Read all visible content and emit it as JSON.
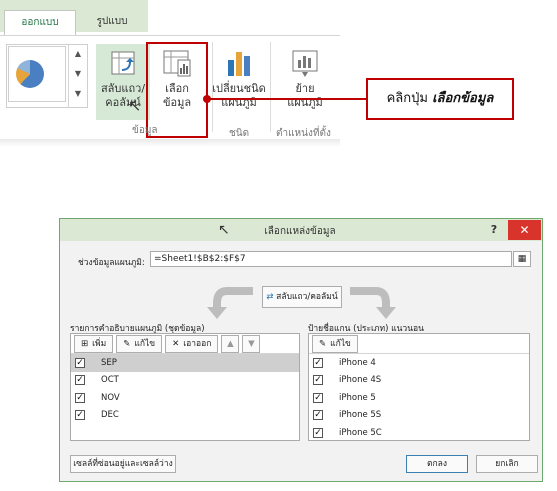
{
  "ribbon": {
    "tabs": [
      "ออกแบบ",
      "รูปแบบ"
    ],
    "buttons": [
      {
        "line1": "สลับแถว/",
        "line2": "คอลัมน์"
      },
      {
        "line1": "เลือก",
        "line2": "ข้อมูล"
      },
      {
        "line1": "เปลี่ยนชนิด",
        "line2": "แผนภูมิ"
      },
      {
        "line1": "ย้าย",
        "line2": "แผนภูมิ"
      }
    ],
    "groups": [
      "ข้อมูล",
      "ชนิด",
      "ตำแหน่งที่ตั้ง"
    ]
  },
  "callout": {
    "prefix": "คลิกปุ่ม ",
    "emphasis": "เลือกข้อมูล"
  },
  "dialog": {
    "title": "เลือกแหล่งข้อมูล",
    "help": "?",
    "close": "✕",
    "range_label": "ช่วงข้อมูลแผนภูมิ:",
    "range_value": "=Sheet1!$B$2:$F$7",
    "switch_label": "สลับแถว/คอลัมน์",
    "left_pane": {
      "label": "รายการคำอธิบายแผนภูมิ (ชุดข้อมูล)",
      "add": "เพิ่ม",
      "edit": "แก้ไข",
      "remove": "เอาออก",
      "items": [
        "SEP",
        "OCT",
        "NOV",
        "DEC"
      ]
    },
    "right_pane": {
      "label": "ป้ายชื่อแกน (ประเภท) แนวนอน",
      "edit": "แก้ไข",
      "items": [
        "iPhone 4",
        "iPhone 4S",
        "iPhone 5",
        "iPhone 5S",
        "iPhone 5C"
      ]
    },
    "hidden_cells": "เซลล์ที่ซ่อนอยู่และเซลล์ว่าง",
    "ok": "ตกลง",
    "cancel": "ยกเลิก"
  },
  "colors": {
    "accent_green": "#217346",
    "callout_red": "#c00000",
    "close_red": "#d9342b"
  }
}
